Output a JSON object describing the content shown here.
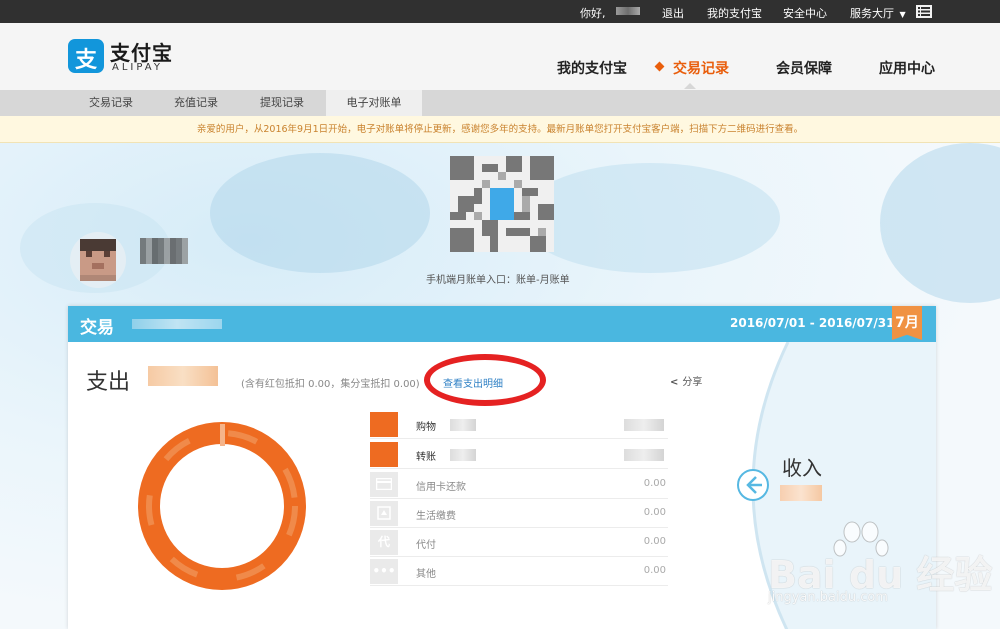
{
  "topbar": {
    "greeting": "你好,",
    "logout": "退出",
    "my_alipay": "我的支付宝",
    "security_center": "安全中心",
    "service_hall": "服务大厅"
  },
  "brand": {
    "logo_char": "支",
    "name_cn": "支付宝",
    "name_en": "ALIPAY",
    "color": "#1296db"
  },
  "main_nav": [
    {
      "label": "我的支付宝",
      "active": false
    },
    {
      "label": "交易记录",
      "active": true
    },
    {
      "label": "会员保障",
      "active": false
    },
    {
      "label": "应用中心",
      "active": false
    }
  ],
  "sub_nav": [
    {
      "label": "交易记录",
      "active": false
    },
    {
      "label": "充值记录",
      "active": false
    },
    {
      "label": "提现记录",
      "active": false
    },
    {
      "label": "电子对账单",
      "active": true
    }
  ],
  "notice": "亲爱的用户，从2016年9月1日开始，电子对账单将停止更新，感谢您多年的支持。最新月账单您打开支付宝客户端，扫描下方二维码进行查看。",
  "qr_caption": "手机端月账单入口：账单-月账单",
  "card": {
    "title": "交易",
    "date_range": "2016/07/01 - 2016/07/31",
    "month_badge": "7月",
    "header_color": "#4ab7e0",
    "expense_label": "支出",
    "expense_note": "(含有红包抵扣 0.00，集分宝抵扣 0.00)",
    "detail_link": "查看支出明细",
    "share_label": "分享",
    "categories": [
      {
        "icon": "",
        "name": "购物",
        "value": "",
        "highlight": true
      },
      {
        "icon": "",
        "name": "转账",
        "value": "",
        "highlight": true
      },
      {
        "icon": "card-icon",
        "name": "信用卡还款",
        "value": "0.00",
        "highlight": false
      },
      {
        "icon": "bill-icon",
        "name": "生活缴费",
        "value": "0.00",
        "highlight": false
      },
      {
        "icon": "代",
        "name": "代付",
        "value": "0.00",
        "highlight": false
      },
      {
        "icon": "dots-icon",
        "name": "其他",
        "value": "0.00",
        "highlight": false
      }
    ],
    "income_label": "收入",
    "accent_color": "#ee6b21"
  },
  "watermark": {
    "text": "Bai du 经验",
    "sub": "jingyan.baidu.com"
  }
}
